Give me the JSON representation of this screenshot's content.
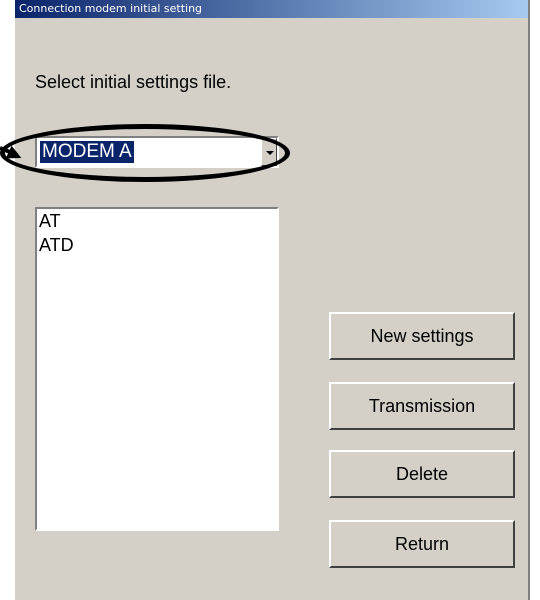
{
  "window": {
    "title": "Connection modem initial setting"
  },
  "prompt": "Select initial settings file.",
  "combo": {
    "selected": "MODEM A"
  },
  "list": {
    "items": [
      "AT",
      "ATD"
    ]
  },
  "buttons": {
    "new_settings": "New settings",
    "transmission": "Transmission",
    "delete": "Delete",
    "return": "Return"
  },
  "colors": {
    "titlebar_start": "#0a246a",
    "titlebar_end": "#a6caf0",
    "window_bg": "#d4d0c8",
    "selection": "#0a246a"
  },
  "annotation": {
    "target": "combo",
    "shape": "ellipse",
    "pointer": "arrow"
  }
}
